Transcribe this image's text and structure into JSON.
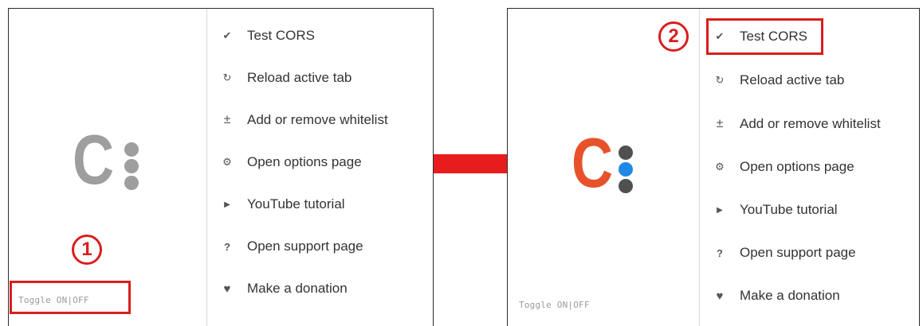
{
  "colors": {
    "highlight": "#d91e1e",
    "logo_inactive": "#9e9e9e",
    "logo_active": "#e8522a",
    "dot_gray": "#505050",
    "dot_active": "#1e88e5"
  },
  "logo": {
    "letter": "C"
  },
  "menu": {
    "items": [
      {
        "icon": "check-icon",
        "label": "Test CORS"
      },
      {
        "icon": "reload-icon",
        "label": "Reload active tab"
      },
      {
        "icon": "plus-minus-icon",
        "label": "Add or remove whitelist"
      },
      {
        "icon": "gear-icon",
        "label": "Open options page"
      },
      {
        "icon": "play-icon",
        "label": "YouTube tutorial"
      },
      {
        "icon": "question-icon",
        "label": "Open support page"
      },
      {
        "icon": "heart-icon",
        "label": "Make a donation"
      }
    ]
  },
  "toggle": {
    "label": "Toggle ON|OFF"
  },
  "steps": {
    "first": "1",
    "second": "2"
  }
}
